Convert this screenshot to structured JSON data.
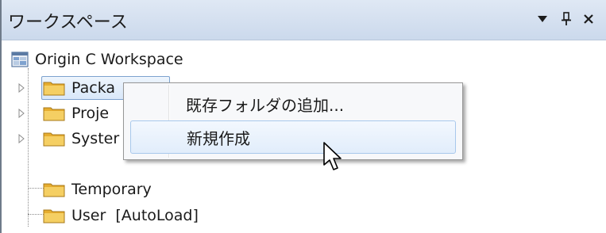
{
  "panel": {
    "title": "ワークスペース",
    "buttons": {
      "dropdown": "▼",
      "pin": "📌",
      "close": "×"
    }
  },
  "tree": {
    "root": {
      "label": "Origin C Workspace",
      "icon": "workspace-icon"
    },
    "items": [
      {
        "label": "Packa",
        "icon": "folder-icon",
        "expandable": true,
        "selected": true
      },
      {
        "label": "Proje",
        "icon": "folder-icon",
        "expandable": true
      },
      {
        "label": "Syster",
        "icon": "folder-icon",
        "expandable": true
      },
      {
        "label": "Temporary",
        "icon": "folder-icon",
        "expandable": false
      },
      {
        "label": "User  [AutoLoad]",
        "icon": "folder-icon",
        "expandable": false
      }
    ]
  },
  "context_menu": {
    "items": [
      {
        "label": "既存フォルダの追加..."
      },
      {
        "label": "新規作成",
        "hover": true
      }
    ]
  },
  "colors": {
    "title_bar": "#cbd9ec",
    "selection_border": "#7da2ce",
    "menu_hover": "#e1edfb",
    "folder": "#f2c34f"
  }
}
